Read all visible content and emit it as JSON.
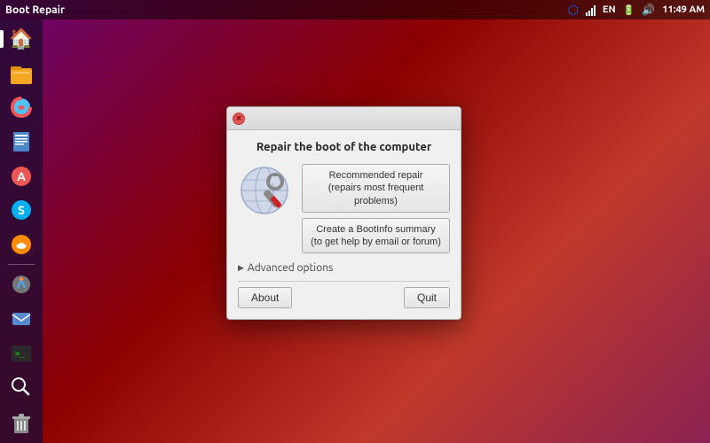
{
  "window_title": "Boot Repair",
  "top_panel": {
    "clock": "11:49 AM"
  },
  "sidebar": {
    "items": [
      {
        "id": "home",
        "icon": "🏠",
        "label": "Home Folder"
      },
      {
        "id": "files",
        "icon": "📁",
        "label": "Files"
      },
      {
        "id": "firefox",
        "icon": "🦊",
        "label": "Firefox"
      },
      {
        "id": "writer",
        "icon": "📝",
        "label": "LibreOffice Writer"
      },
      {
        "id": "appstore",
        "icon": "🅰",
        "label": "Ubuntu Software Center"
      },
      {
        "id": "skype",
        "icon": "💬",
        "label": "Skype"
      },
      {
        "id": "orca",
        "icon": "🍊",
        "label": "Orca"
      },
      {
        "id": "gimp",
        "icon": "🎨",
        "label": "GIMP"
      },
      {
        "id": "email",
        "icon": "✉",
        "label": "Thunderbird"
      },
      {
        "id": "terminal",
        "icon": "🖥",
        "label": "Terminal"
      },
      {
        "id": "search",
        "icon": "🔍",
        "label": "Search"
      },
      {
        "id": "trash",
        "icon": "🗑",
        "label": "Trash"
      }
    ]
  },
  "dialog": {
    "title": "Repair the boot of the computer",
    "recommended_repair_line1": "Recommended repair",
    "recommended_repair_line2": "(repairs most frequent problems)",
    "bootinfo_line1": "Create a BootInfo summary",
    "bootinfo_line2": "(to get help by email or forum)",
    "advanced_options_label": "Advanced options",
    "about_label": "About",
    "quit_label": "Quit"
  }
}
